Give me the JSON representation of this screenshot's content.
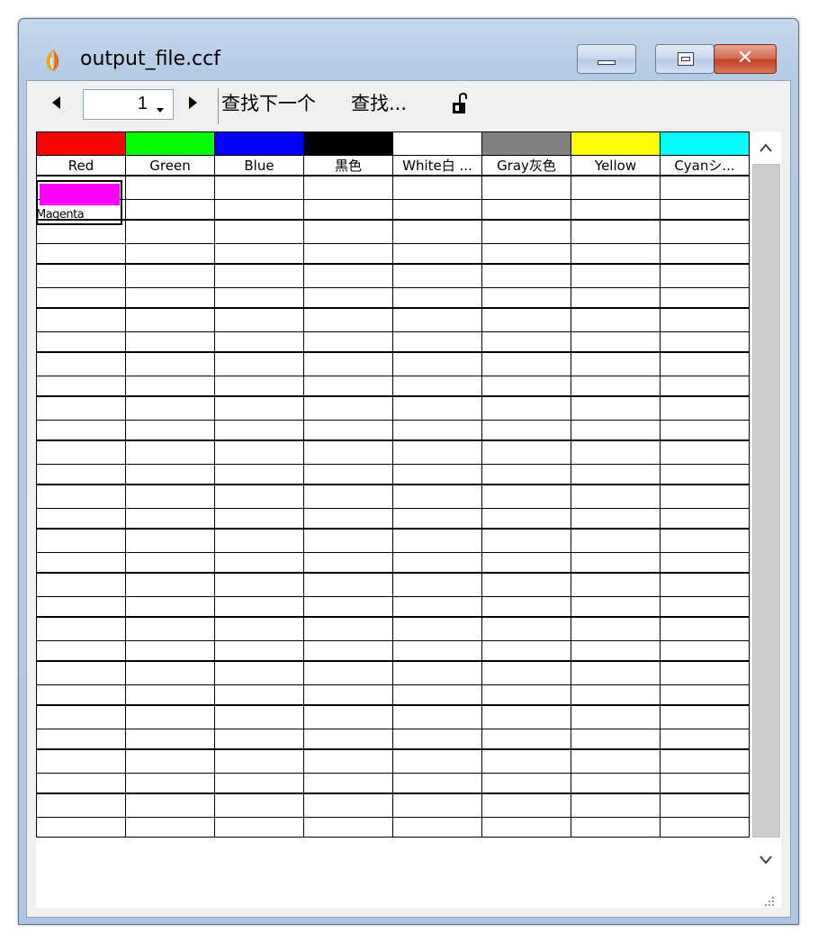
{
  "window": {
    "title": "output_file.ccf",
    "buttons": {
      "minimize": "minimize",
      "maximize": "maximize",
      "close": "close"
    }
  },
  "toolbar": {
    "page_value": "1",
    "find_next_label": "查找下一个",
    "find_label": "查找...",
    "prev_icon": "triangle-left-icon",
    "next_icon": "triangle-right-icon",
    "lock_icon": "unlock-icon"
  },
  "colors": [
    {
      "name": "Red",
      "hex": "#ff0000"
    },
    {
      "name": "Green",
      "hex": "#00ff00"
    },
    {
      "name": "Blue",
      "hex": "#0000ff"
    },
    {
      "name": "黒色",
      "hex": "#000000"
    },
    {
      "name": "White白 ...",
      "hex": "#ffffff"
    },
    {
      "name": "Gray灰色",
      "hex": "#808080"
    },
    {
      "name": "Yellow",
      "hex": "#ffff00"
    },
    {
      "name": "Cyanシ...",
      "hex": "#00ffff"
    },
    {
      "name": "Magenta",
      "hex": "#ff00ff"
    }
  ]
}
